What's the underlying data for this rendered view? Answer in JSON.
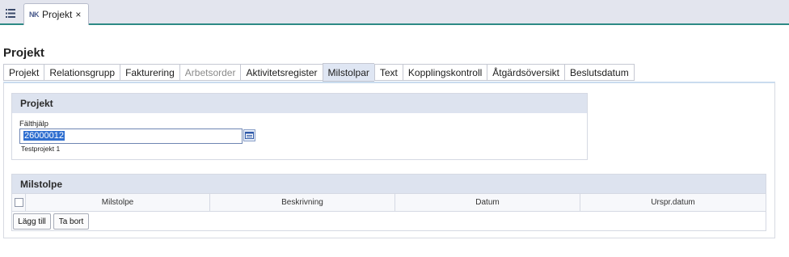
{
  "topbar": {
    "menu_icon": "list-icon",
    "tab": {
      "badge": "NK",
      "label": "Projekt",
      "close": "×"
    }
  },
  "page_title": "Projekt",
  "tabs": [
    {
      "label": "Projekt",
      "state": "normal"
    },
    {
      "label": "Relationsgrupp",
      "state": "normal"
    },
    {
      "label": "Fakturering",
      "state": "normal"
    },
    {
      "label": "Arbetsorder",
      "state": "disabled"
    },
    {
      "label": "Aktivitetsregister",
      "state": "normal"
    },
    {
      "label": "Milstolpar",
      "state": "active"
    },
    {
      "label": "Text",
      "state": "normal"
    },
    {
      "label": "Kopplingskontroll",
      "state": "normal"
    },
    {
      "label": "Åtgärdsöversikt",
      "state": "normal"
    },
    {
      "label": "Beslutsdatum",
      "state": "normal"
    }
  ],
  "project_panel": {
    "title": "Projekt",
    "field_label": "Fälthjälp",
    "field_value": "26000012",
    "field_description": "Testprojekt 1",
    "lookup_icon": "lookup-icon"
  },
  "milestone_panel": {
    "title": "Milstolpe",
    "columns": [
      "Milstolpe",
      "Beskrivning",
      "Datum",
      "Urspr.datum"
    ],
    "add_button": "Lägg till",
    "remove_button": "Ta bort"
  },
  "colors": {
    "accent_line": "#2d8a85",
    "panel_header": "#dde3ef",
    "selection": "#2f6fd0"
  }
}
